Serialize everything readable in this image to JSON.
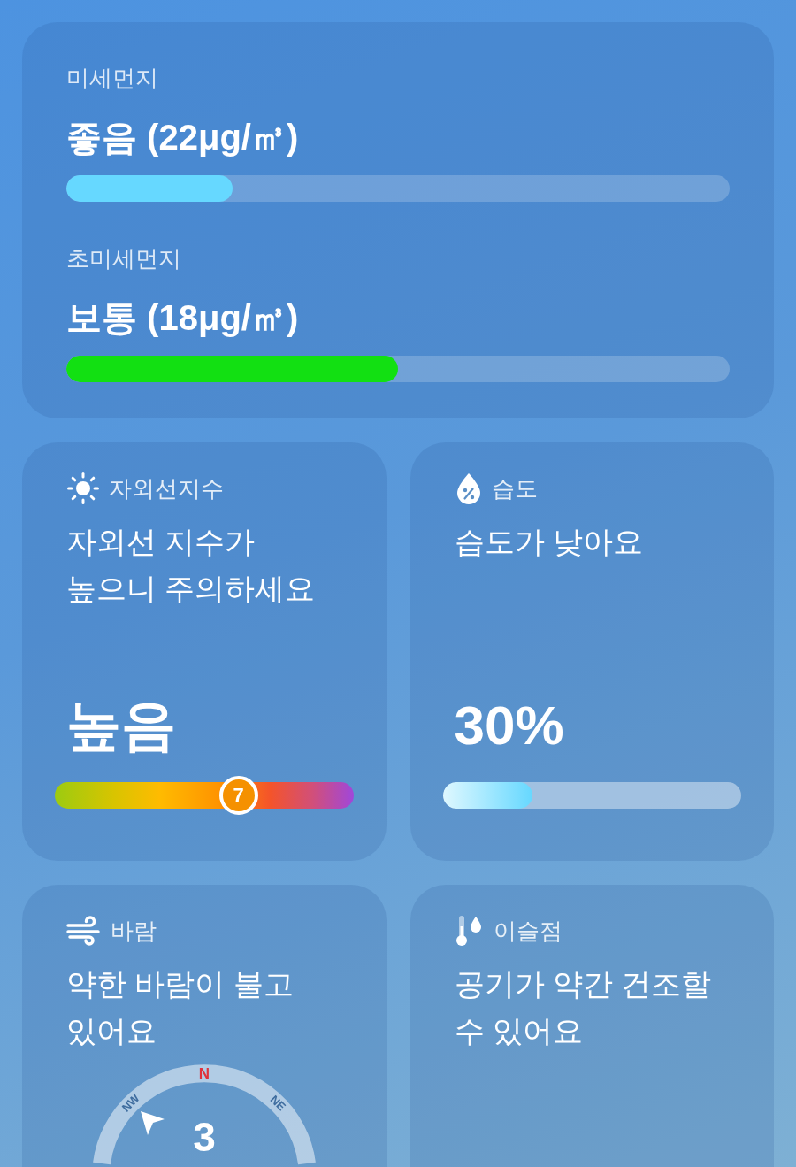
{
  "air_quality": {
    "items": [
      {
        "label": "미세먼지",
        "value": "좋음 (22μg/㎥)",
        "level": 0.25,
        "color": "#66d8ff"
      },
      {
        "label": "초미세먼지",
        "value": "보통 (18μg/㎥)",
        "level": 0.5,
        "color": "#12e012"
      }
    ]
  },
  "cards": [
    {
      "kind": "uv",
      "title": "자외선지수",
      "lines": [
        "자외선 지수가",
        "높으니 주의하세요"
      ],
      "value": "높음",
      "level": 0.615,
      "marker": "7"
    },
    {
      "kind": "humidity",
      "title": "습도",
      "lines": [
        "습도가 낮아요"
      ],
      "value": "30%",
      "level": 0.3
    },
    {
      "kind": "wind",
      "title": "바람",
      "lines": [
        "약한 바람이 불고",
        "있어요"
      ],
      "compass": {
        "north": "N",
        "northwest": "NW",
        "northeast": "NE",
        "speed": "3"
      }
    },
    {
      "kind": "dew_point",
      "title": "이슬점",
      "lines": [
        "공기가 약간 건조할",
        "수 있어요"
      ]
    }
  ]
}
